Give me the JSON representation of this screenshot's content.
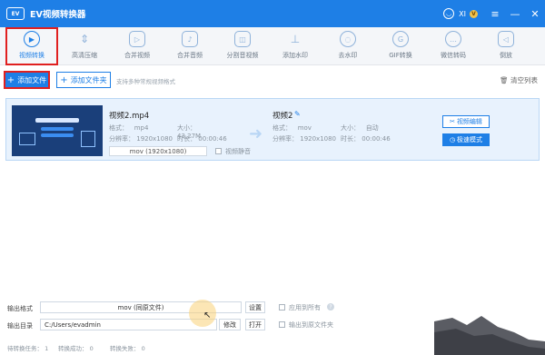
{
  "app": {
    "logo_text": "EV",
    "title": "EV视频转换器",
    "user": "XI",
    "vip_badge": "V",
    "window_buttons": [
      "≡",
      "—",
      "✕"
    ]
  },
  "toolbar": {
    "items": [
      {
        "label": "视频转换",
        "icon": "convert-icon"
      },
      {
        "label": "高清压缩",
        "icon": "compress-icon"
      },
      {
        "label": "合并视频",
        "icon": "merge-video-icon"
      },
      {
        "label": "合并音频",
        "icon": "merge-audio-icon"
      },
      {
        "label": "分割音视频",
        "icon": "split-icon"
      },
      {
        "label": "添加水印",
        "icon": "watermark-icon"
      },
      {
        "label": "去水印",
        "icon": "remove-watermark-icon"
      },
      {
        "label": "GIF转换",
        "icon": "gif-icon"
      },
      {
        "label": "微信转码",
        "icon": "wechat-icon"
      },
      {
        "label": "倒放",
        "icon": "reverse-icon"
      }
    ]
  },
  "actions": {
    "add_file": "添加文件",
    "add_folder": "添加文件夹",
    "hint": "支持多种常规视频格式",
    "clear_list": "清空列表"
  },
  "file_item": {
    "source": {
      "name": "视频2.mp4",
      "format_label": "格式：",
      "format": "mp4",
      "size_label": "大小：",
      "size": "43.27M",
      "resolution_label": "分辨率：",
      "resolution": "1920x1080",
      "duration_label": "时长：",
      "duration": "00:00:46",
      "output_format": "mov (1920x1080)",
      "mute_label": "视频静音"
    },
    "output": {
      "name": "视频2",
      "format_label": "格式：",
      "format": "mov",
      "size_label": "大小：",
      "size": "自动",
      "resolution_label": "分辨率：",
      "resolution": "1920x1080",
      "duration_label": "时长：",
      "duration": "00:00:46"
    },
    "edit_button": "视频编辑",
    "fast_button": "极速模式"
  },
  "bottom": {
    "format_label": "输出格式",
    "format_value": "mov (同原文件)",
    "settings": "设置",
    "apply_all": "应用到所有",
    "dir_label": "输出目录",
    "dir_value": "C:/Users/evadmin",
    "modify": "修改",
    "open": "打开",
    "output_to_source": "输出到原文件夹",
    "pending_label": "待转换任务：",
    "pending": "1",
    "success_label": "转换成功：",
    "success": "0",
    "fail_label": "转换失败：",
    "fail": "0"
  },
  "colors": {
    "primary": "#1e7fe6",
    "highlight": "#e02020",
    "item_bg": "#e8f2fd"
  }
}
